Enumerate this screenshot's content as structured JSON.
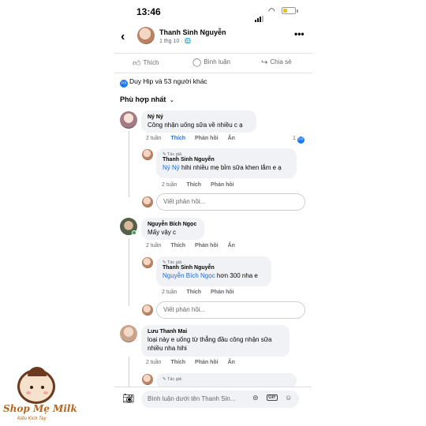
{
  "status_bar": {
    "time": "13:46"
  },
  "post_header": {
    "poster_name": "Thanh Sinh Nguyễn",
    "meta": "1 thg 10 · 🌐"
  },
  "actions": {
    "like": "Thích",
    "comment": "Bình luận",
    "share": "Chia sẻ"
  },
  "reactions": {
    "summary": "Duy Hip và 53 người khác"
  },
  "sort": {
    "label": "Phù hợp nhất"
  },
  "comments": [
    {
      "name": "Ný Ný",
      "text": "Công nhận uống sữa về nhiều c ạ",
      "time": "2 tuần",
      "like": "Thích",
      "reply": "Phản hồi",
      "hide": "Ẩn",
      "reaction_count": "1",
      "reply_item": {
        "author_tag": "✎ Tác giả",
        "name": "Thanh Sinh Nguyễn",
        "mention": "Ný Ný",
        "text": " hihi nhiều mẹ bỉm sữa khen lắm e ạ",
        "time": "2 tuần",
        "like": "Thích",
        "reply": "Phản hồi"
      },
      "reply_placeholder": "Viết phản hồi..."
    },
    {
      "name": "Nguyễn Bích Ngọc",
      "text": "Mấy vậy c",
      "time": "2 tuần",
      "like": "Thích",
      "reply": "Phản hồi",
      "hide": "Ẩn",
      "reply_item": {
        "author_tag": "✎ Tác giả",
        "name": "Thanh Sinh Nguyễn",
        "mention": "Nguyễn Bích Ngọc",
        "text": " hơn 300 nha e",
        "time": "2 tuần",
        "like": "Thích",
        "reply": "Phản hồi"
      },
      "reply_placeholder": "Viết phản hồi..."
    },
    {
      "name": "Lưu Thanh Mai",
      "text_line1": "loại này e uống từ thẳng đầu công nhận sữa",
      "text_line2": "nhiều nha hihi",
      "time": "2 tuần",
      "like": "Thích",
      "reply": "Phản hồi",
      "hide": "Ẩn",
      "reply_item": {
        "author_tag": "✎ Tác giả"
      }
    }
  ],
  "compose": {
    "placeholder": "Bình luận dưới tên Thanh Sin..."
  },
  "watermark": {
    "name": "Shop Mẹ Milk",
    "sub": "Kiếu Kich Tay"
  }
}
